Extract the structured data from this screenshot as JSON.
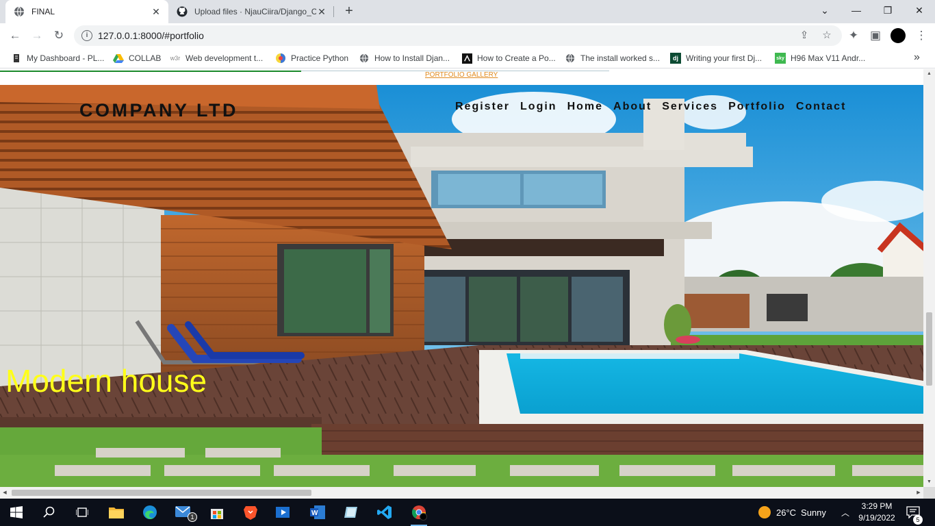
{
  "browser": {
    "tabs": [
      {
        "title": "FINAL",
        "icon": "globe-icon",
        "active": true
      },
      {
        "title": "Upload files · NjauCiira/Django_C",
        "icon": "github-icon",
        "active": false
      }
    ],
    "new_tab_glyph": "+",
    "url": "127.0.0.1:8000/#portfolio",
    "bookmarks": [
      {
        "label": "My Dashboard - PL...",
        "icon": "bookmark-favicon"
      },
      {
        "label": "COLLAB",
        "icon": "google-drive-icon"
      },
      {
        "label": "Web development t...",
        "icon": "w3schools-icon",
        "icon_text": "w3r"
      },
      {
        "label": "Practice Python",
        "icon": "practice-python-icon"
      },
      {
        "label": "How to Install Djan...",
        "icon": "globe-icon"
      },
      {
        "label": "How to Create a Po...",
        "icon": "site-favicon"
      },
      {
        "label": "The install worked s...",
        "icon": "globe-icon"
      },
      {
        "label": "Writing your first Dj...",
        "icon": "django-icon",
        "icon_text": "dj"
      },
      {
        "label": "H96 Max V11 Andr...",
        "icon": "shop-icon",
        "icon_text": "sky"
      }
    ]
  },
  "page": {
    "top_link": "PORTFOLIO GALLERY",
    "brand": "COMPANY LTD",
    "nav": [
      "Register",
      "Login",
      "Home",
      "About",
      "Services",
      "Portfolio",
      "Contact"
    ],
    "hero_title": "Modern house",
    "colors": {
      "hero_title": "#ffff1a",
      "top_link": "#e08a1e",
      "accent_line": "#1a8a2a"
    }
  },
  "taskbar": {
    "apps": [
      "start-icon",
      "search-icon",
      "task-view-icon",
      "file-explorer-icon",
      "edge-icon",
      "mail-icon",
      "store-icon",
      "brave-icon",
      "media-player-icon",
      "word-icon",
      "app-icon",
      "vscode-icon",
      "chrome-icon"
    ],
    "mail_badge": "1",
    "weather": {
      "temp": "26°C",
      "condition": "Sunny"
    },
    "time": "3:29 PM",
    "date": "9/19/2022",
    "notifications": "5"
  }
}
